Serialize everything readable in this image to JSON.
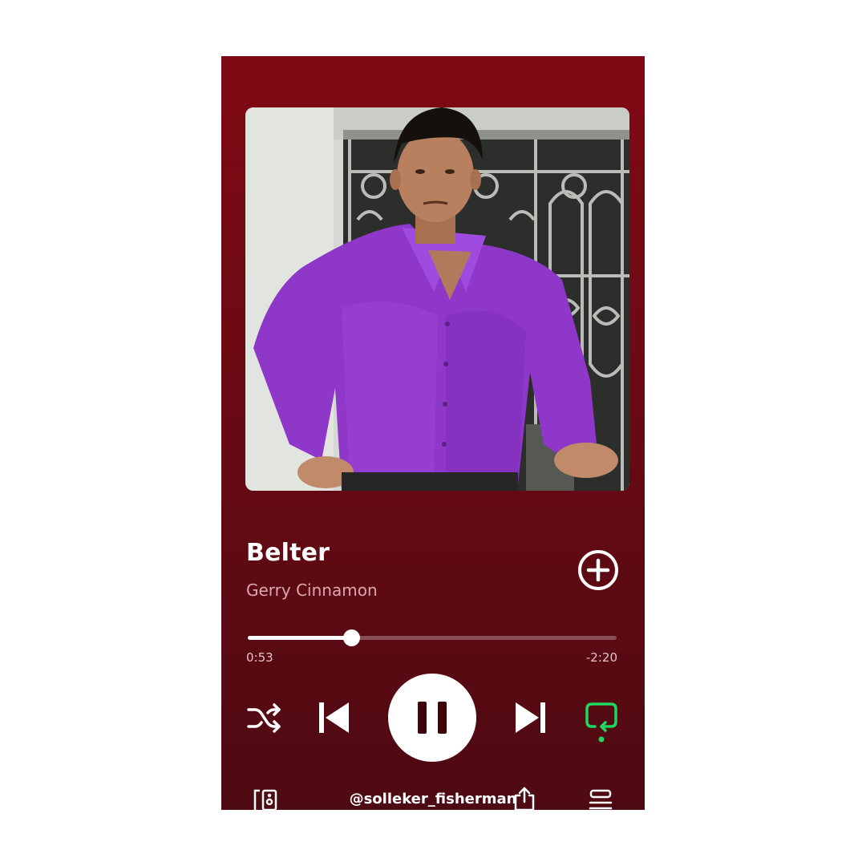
{
  "track": {
    "title": "Belter",
    "artist": "Gerry Cinnamon"
  },
  "playback": {
    "elapsed": "0:53",
    "remaining": "-2:20",
    "progress_fraction": 0.28,
    "state": "playing",
    "shuffle": "off",
    "repeat": "on"
  },
  "footer": {
    "handle": "@solleker_fisherman"
  },
  "icons": {
    "add": "add-circle-icon",
    "shuffle": "shuffle-icon",
    "previous": "skip-previous-icon",
    "pause": "pause-icon",
    "next": "skip-next-icon",
    "repeat": "repeat-icon",
    "devices": "connect-device-icon",
    "share": "share-icon",
    "queue": "queue-icon"
  },
  "colors": {
    "background_top": "#7f0914",
    "background_bottom": "#4e0a12",
    "accent_active": "#1ed760",
    "text_primary": "#ffffff",
    "text_secondary": "#d9a9ad"
  }
}
